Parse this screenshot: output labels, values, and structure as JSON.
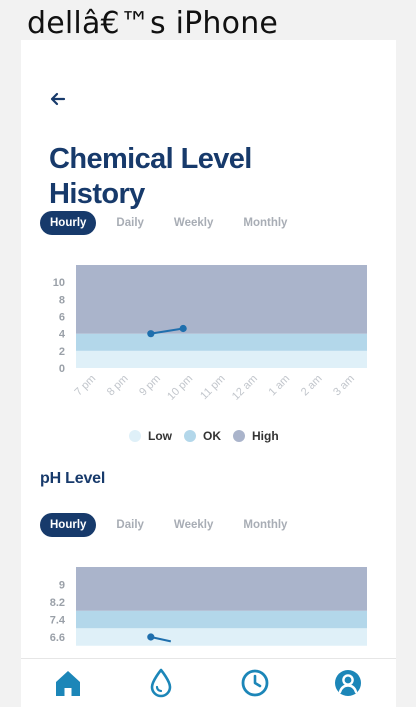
{
  "device_name": "dellâ€™s iPhone",
  "page_title": "Chemical Level History",
  "icons": {
    "back": "arrow-left-icon",
    "nav": [
      "home-icon",
      "water-drop-icon",
      "clock-icon",
      "user-icon"
    ]
  },
  "colors": {
    "primary": "#173a6b",
    "line": "#1f6fad",
    "low": "#dff0f8",
    "ok": "#b3d7ea",
    "high": "#aab4cb",
    "nav_icon": "#1c86b8"
  },
  "tabs1": [
    "Hourly",
    "Daily",
    "Weekly",
    "Monthly"
  ],
  "tabs2": [
    "Hourly",
    "Daily",
    "Weekly",
    "Monthly"
  ],
  "tabs_active": "Hourly",
  "section2_title": "pH Level",
  "legend": [
    {
      "label": "Low",
      "color": "#dff0f8"
    },
    {
      "label": "OK",
      "color": "#b3d7ea"
    },
    {
      "label": "High",
      "color": "#aab4cb"
    }
  ],
  "chart_data": [
    {
      "type": "line",
      "x": [
        "7 pm",
        "8 pm",
        "9 pm",
        "10 pm",
        "11 pm",
        "12 am",
        "1 am",
        "2 am",
        "3 am"
      ],
      "y_ticks": [
        "0",
        "2",
        "4",
        "6",
        "8",
        "10"
      ],
      "ylim": [
        0,
        12
      ],
      "bands": [
        {
          "name": "Low",
          "range": [
            0,
            2
          ]
        },
        {
          "name": "OK",
          "range": [
            2,
            4
          ]
        },
        {
          "name": "High",
          "range": [
            4,
            12
          ]
        }
      ],
      "series": [
        {
          "values": [
            null,
            null,
            4.0,
            4.6,
            null,
            null,
            null,
            null,
            null
          ]
        }
      ],
      "grid": false,
      "legend_position": "bottom"
    },
    {
      "type": "line",
      "y_ticks": [
        "6.6",
        "7.4",
        "8.2",
        "9"
      ],
      "y_tick_values": [
        6.6,
        7.4,
        8.2,
        9
      ],
      "bands": [
        {
          "name": "Low",
          "range": [
            6.2,
            7.0
          ]
        },
        {
          "name": "OK",
          "range": [
            7.0,
            7.8
          ]
        },
        {
          "name": "High",
          "range": [
            7.8,
            9.8
          ]
        }
      ],
      "series": [
        {
          "values": [
            null,
            null,
            6.6,
            6.4
          ]
        }
      ],
      "grid": false
    }
  ]
}
